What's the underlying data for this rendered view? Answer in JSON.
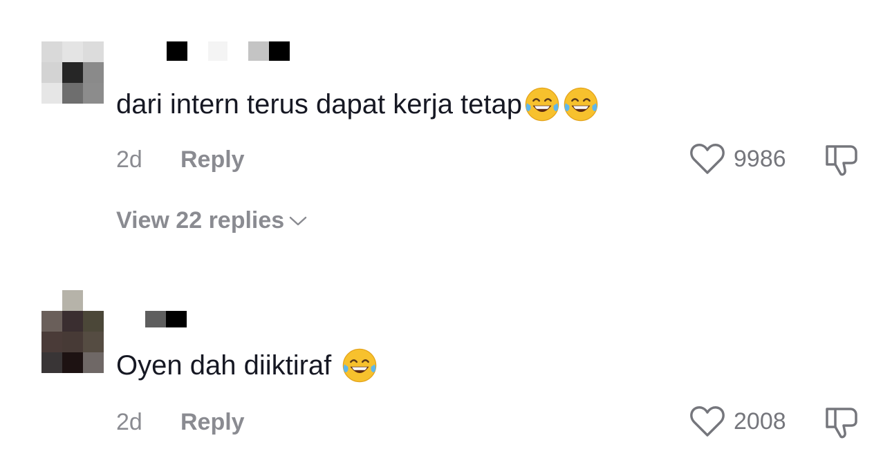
{
  "comments": [
    {
      "text": "dari intern terus dapat kerja tetap",
      "emoji_count": 2,
      "time": "2d",
      "reply_label": "Reply",
      "likes": "9986",
      "view_replies_label": "View 22 replies"
    },
    {
      "text": "Oyen dah diiktiraf",
      "emoji_count": 1,
      "time": "2d",
      "reply_label": "Reply",
      "likes": "2008"
    }
  ],
  "icons": {
    "like": "heart-outline-icon",
    "dislike": "thumbs-down-outline-icon",
    "emoji": "face-with-tears-of-joy",
    "expand": "chevron-down-icon"
  },
  "colors": {
    "text": "#161823",
    "muted": "#8a8b91",
    "emoji_face": "#f7c12d"
  }
}
